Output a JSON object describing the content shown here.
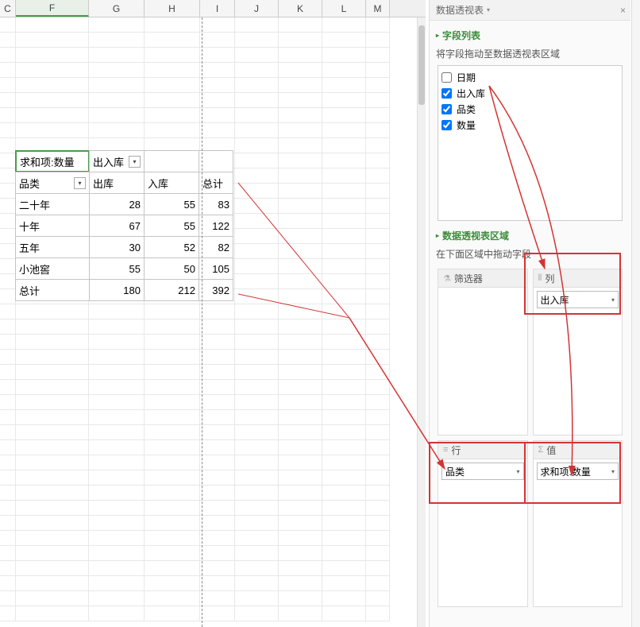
{
  "panel": {
    "title": "数据透视表",
    "section_fields": "字段列表",
    "section_fields_desc": "将字段拖动至数据透视表区域",
    "section_areas": "数据透视表区域",
    "section_areas_desc": "在下面区域中拖动字段",
    "fields": [
      {
        "label": "日期",
        "checked": false
      },
      {
        "label": "出入库",
        "checked": true
      },
      {
        "label": "品类",
        "checked": true
      },
      {
        "label": "数量",
        "checked": true
      }
    ],
    "area": {
      "filter_label": "筛选器",
      "column_label": "列",
      "row_label": "行",
      "values_label": "值",
      "column_field": "出入库",
      "row_field": "品类",
      "values_field": "求和项:数量"
    }
  },
  "columns": [
    "C",
    "F",
    "G",
    "H",
    "I",
    "J",
    "K",
    "L",
    "M"
  ],
  "selected_col": "F",
  "pivot": {
    "corner": "求和项:数量",
    "col_field": "出入库",
    "row_field": "品类",
    "col_headers": [
      "出库",
      "入库",
      "总计"
    ],
    "rows": [
      {
        "label": "二十年",
        "values": [
          28,
          55,
          83
        ]
      },
      {
        "label": "十年",
        "values": [
          67,
          55,
          122
        ]
      },
      {
        "label": "五年",
        "values": [
          30,
          52,
          82
        ]
      },
      {
        "label": "小池窖",
        "values": [
          55,
          50,
          105
        ]
      }
    ],
    "total_label": "总计",
    "totals": [
      180,
      212,
      392
    ]
  },
  "chart_data": {
    "type": "table",
    "title": "求和项:数量",
    "row_field": "品类",
    "col_field": "出入库",
    "columns": [
      "出库",
      "入库",
      "总计"
    ],
    "rows": [
      "二十年",
      "十年",
      "五年",
      "小池窖",
      "总计"
    ],
    "values": [
      [
        28,
        55,
        83
      ],
      [
        67,
        55,
        122
      ],
      [
        30,
        52,
        82
      ],
      [
        55,
        50,
        105
      ],
      [
        180,
        212,
        392
      ]
    ]
  }
}
